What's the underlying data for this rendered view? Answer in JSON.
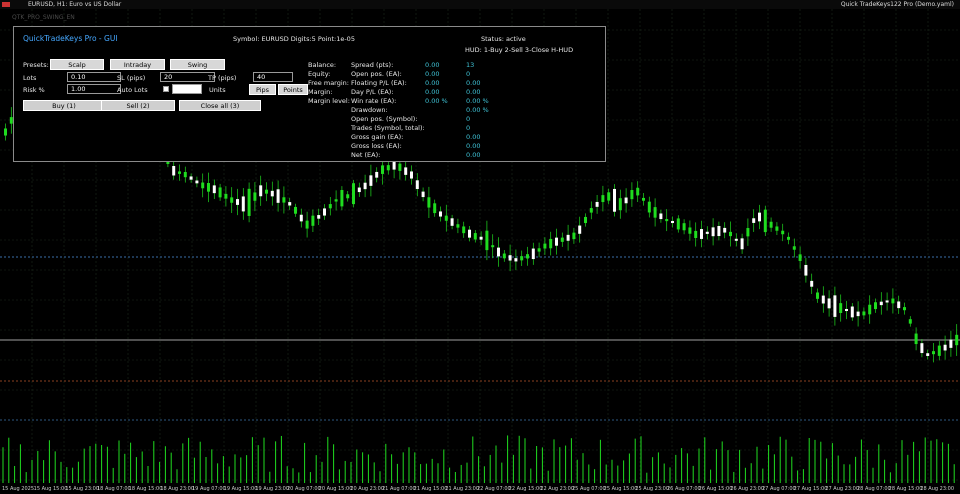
{
  "window": {
    "left_title": "EURUSD, H1: Euro vs US Dollar",
    "right_title": "Quick TradeKeys122 Pro (Demo.yaml)",
    "sub_title": "QTK_PRO_SWING_EN"
  },
  "panel": {
    "title": "QuickTradeKeys Pro - GUI",
    "symbol_info": "Symbol: EURUSD  Digits:5  Point:1e-05",
    "status": "Status: active",
    "hud_help": "HUD: 1-Buy  2-Sell  3-Close  H-HUD",
    "presets_label": "Presets:",
    "presets": [
      "Scalp",
      "Intraday",
      "Swing"
    ],
    "lots_label": "Lots",
    "lots_value": "0.10",
    "sl_label": "SL (pips)",
    "sl_value": "20",
    "tp_label": "TP (pips)",
    "tp_value": "40",
    "risk_label": "Risk %",
    "risk_value": "1.00",
    "autolots_label": "Auto Lots",
    "units_label": "Units",
    "units_buttons": [
      "Pips",
      "Points"
    ],
    "actions": [
      "Buy (1)",
      "Sell (2)",
      "Close all (3)"
    ],
    "account_labels": [
      "Balance:",
      "Equity:",
      "Free margin:",
      "Margin:",
      "Margin level:"
    ],
    "stats": [
      {
        "label": "Spread (pts):",
        "v1": "0.00",
        "v2": "13"
      },
      {
        "label": "Open pos. (EA):",
        "v1": "0.00",
        "v2": "0"
      },
      {
        "label": "Floating P/L (EA):",
        "v1": "0.00",
        "v2": "0.00"
      },
      {
        "label": "Day P/L (EA):",
        "v1": "0.00",
        "v2": "0.00"
      },
      {
        "label": "Win rate (EA):",
        "v1": "0.00 %",
        "v2": "0.00 %"
      },
      {
        "label": "Drawdown:",
        "v1": "",
        "v2": "0.00 %"
      },
      {
        "label": "Open pos. (Symbol):",
        "v1": "",
        "v2": "0"
      },
      {
        "label": "Trades (Symbol, total):",
        "v1": "",
        "v2": "0"
      },
      {
        "label": "Gross gain (EA):",
        "v1": "",
        "v2": "0.00"
      },
      {
        "label": "Gross loss (EA):",
        "v1": "",
        "v2": "0.00"
      },
      {
        "label": "Net (EA):",
        "v1": "",
        "v2": "0.00"
      }
    ]
  },
  "time_axis": [
    "15 Aug 2025",
    "15 Aug 15:00",
    "15 Aug 23:00",
    "18 Aug 07:00",
    "18 Aug 15:00",
    "18 Aug 23:00",
    "19 Aug 07:00",
    "19 Aug 15:00",
    "19 Aug 23:00",
    "20 Aug 07:00",
    "20 Aug 15:00",
    "20 Aug 23:00",
    "21 Aug 07:00",
    "21 Aug 15:00",
    "21 Aug 23:00",
    "22 Aug 07:00",
    "22 Aug 15:00",
    "22 Aug 23:00",
    "25 Aug 07:00",
    "25 Aug 15:00",
    "25 Aug 23:00",
    "26 Aug 07:00",
    "26 Aug 15:00",
    "26 Aug 23:00",
    "27 Aug 07:00",
    "27 Aug 15:00",
    "27 Aug 23:00",
    "28 Aug 07:00",
    "28 Aug 15:00",
    "28 Aug 23:00"
  ],
  "colors": {
    "bull": "#ffffff",
    "bear": "#1fdc1f",
    "grid": "#1d2a1d",
    "bid_line": "#a0a0a0",
    "level_blue": "#3a6ea8",
    "level_orange": "#8a4020",
    "volume": "#1fdc1f"
  }
}
